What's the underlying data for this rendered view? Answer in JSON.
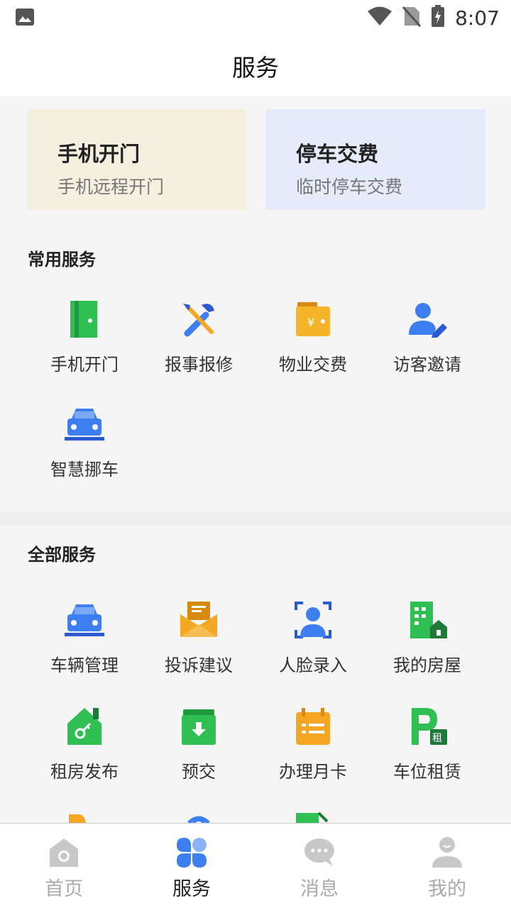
{
  "status_bar": {
    "time": "8:07"
  },
  "header": {
    "title": "服务"
  },
  "quick_cards": [
    {
      "title": "手机开门",
      "subtitle": "手机远程开门",
      "icon": "door-icon"
    },
    {
      "title": "停车交费",
      "subtitle": "临时停车交费",
      "icon": "parking-icon"
    }
  ],
  "common_services": {
    "title": "常用服务",
    "items": [
      {
        "label": "手机开门",
        "icon": "door-icon"
      },
      {
        "label": "报事报修",
        "icon": "repair-tools-icon"
      },
      {
        "label": "物业交费",
        "icon": "wallet-yen-icon"
      },
      {
        "label": "访客邀请",
        "icon": "visitor-icon"
      },
      {
        "label": "智慧挪车",
        "icon": "car-icon"
      }
    ]
  },
  "all_services": {
    "title": "全部服务",
    "items": [
      {
        "label": "车辆管理",
        "icon": "car-icon"
      },
      {
        "label": "投诉建议",
        "icon": "mail-icon"
      },
      {
        "label": "人脸录入",
        "icon": "face-scan-icon"
      },
      {
        "label": "我的房屋",
        "icon": "building-icon"
      },
      {
        "label": "租房发布",
        "icon": "house-key-icon"
      },
      {
        "label": "预交",
        "icon": "box-download-icon"
      },
      {
        "label": "办理月卡",
        "icon": "calendar-card-icon"
      },
      {
        "label": "车位租赁",
        "icon": "parking-rent-icon"
      }
    ]
  },
  "tabbar": {
    "items": [
      {
        "label": "首页",
        "icon": "home-icon"
      },
      {
        "label": "服务",
        "icon": "grid-icon"
      },
      {
        "label": "消息",
        "icon": "chat-icon"
      },
      {
        "label": "我的",
        "icon": "user-icon"
      }
    ],
    "active_index": 1
  },
  "colors": {
    "accent_blue": "#3d7ef0",
    "green": "#2fbf52",
    "orange": "#f5a623"
  }
}
